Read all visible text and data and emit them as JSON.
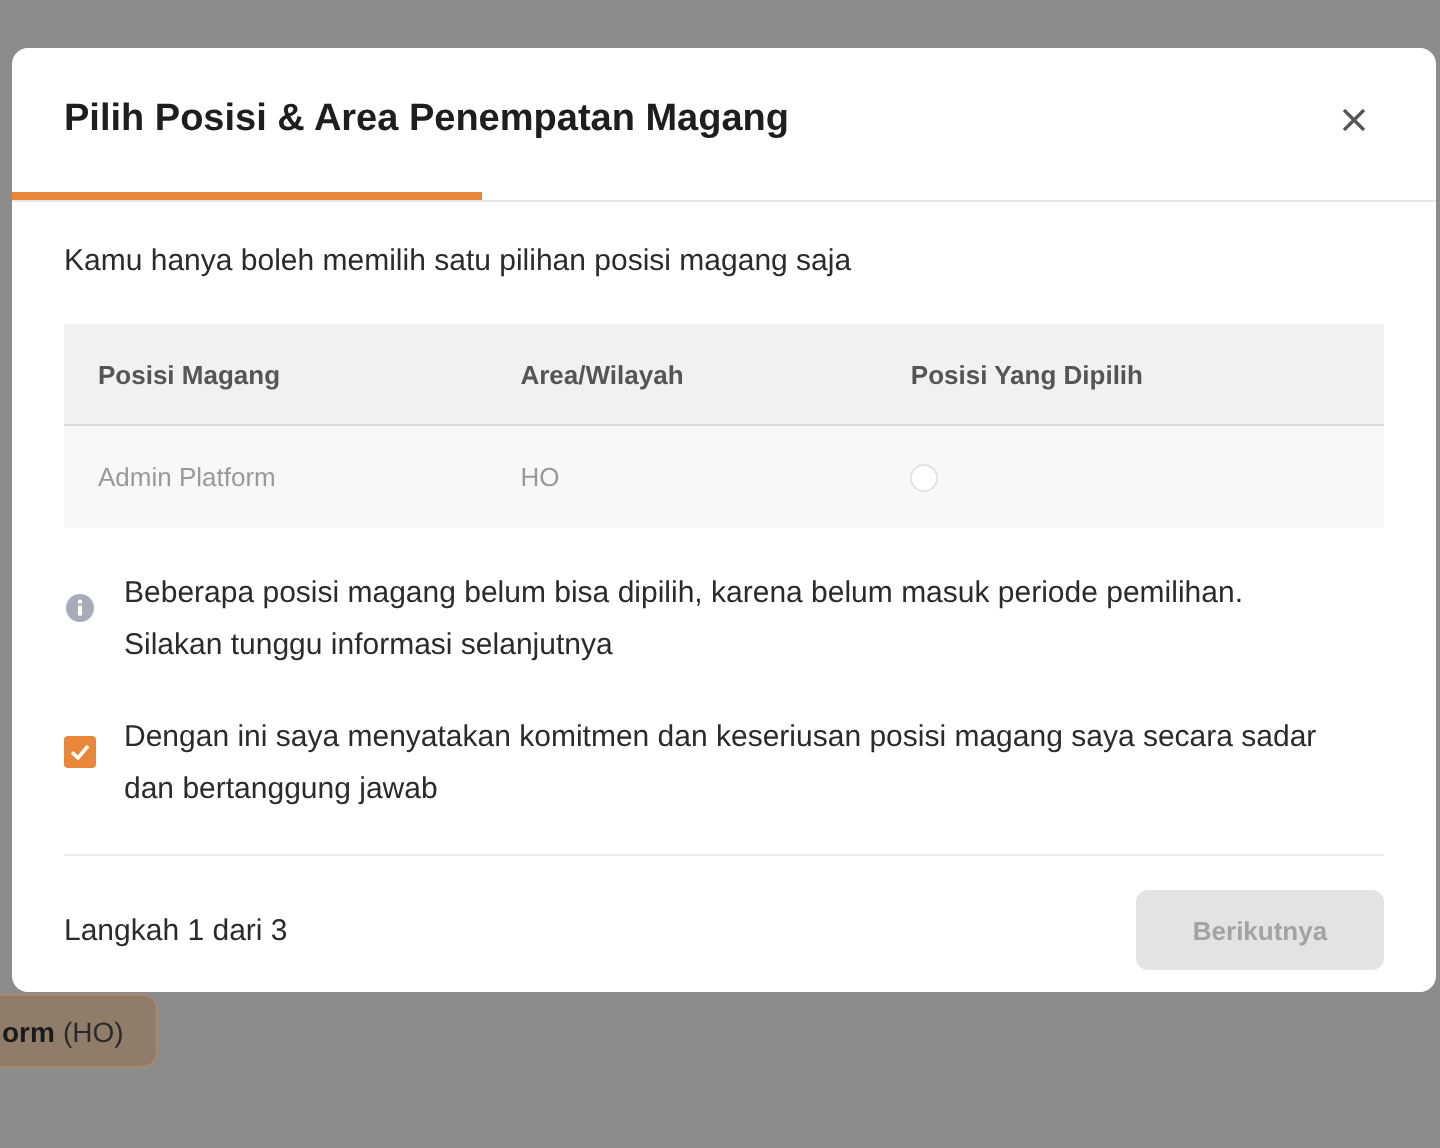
{
  "background": {
    "card": {
      "name": "orm",
      "area": "(HO)"
    }
  },
  "dialog": {
    "title": "Pilih Posisi & Area Penempatan Magang",
    "progress": {
      "level": 0.33
    },
    "note": "Kamu hanya boleh memilih satu pilihan posisi magang saja",
    "table": {
      "columns": [
        "Posisi Magang",
        "Area/Wilayah",
        "Posisi Yang Dipilih"
      ],
      "rows": [
        {
          "position": "Admin Platform",
          "area": "HO",
          "selected": false,
          "disabled": true
        }
      ]
    },
    "info": "Beberapa posisi magang belum bisa dipilih, karena belum masuk periode pemilihan. Silakan tunggu informasi selanjutnya",
    "agreement": {
      "text": "Dengan ini saya menyatakan komitmen dan keseriusan posisi magang saya secara sadar dan bertanggung jawab",
      "checked": true
    },
    "step": "Langkah 1 dari 3",
    "next_button": {
      "label": "Berikutnya",
      "disabled": true
    }
  }
}
